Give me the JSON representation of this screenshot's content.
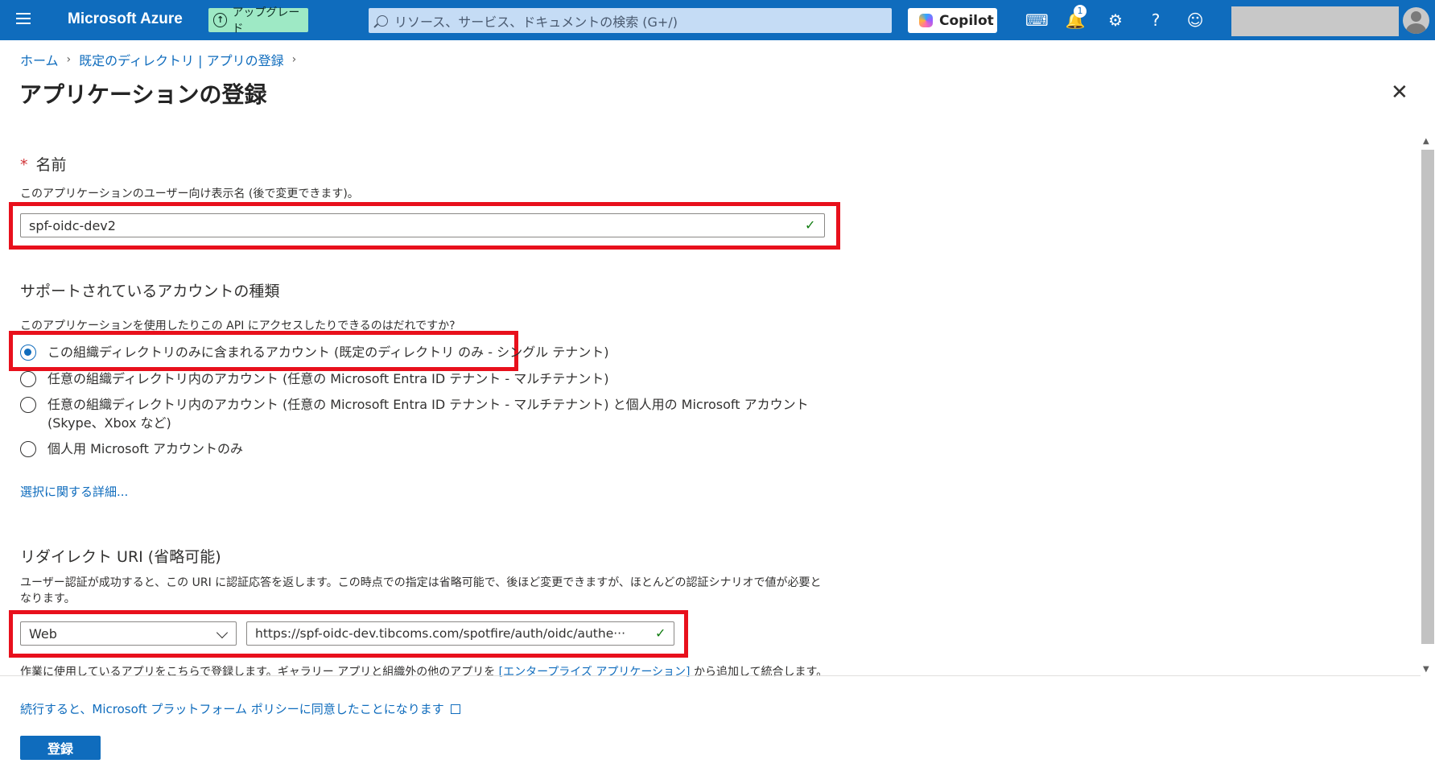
{
  "header": {
    "brand": "Microsoft Azure",
    "upgrade_label": "アップグレード",
    "search_placeholder": "リソース、サービス、ドキュメントの検索 (G+/)",
    "copilot_label": "Copilot",
    "notification_count": "1",
    "accent_color": "#0f6cbd"
  },
  "breadcrumb": {
    "home": "ホーム",
    "directory": "既定のディレクトリ | アプリの登録"
  },
  "page": {
    "title": "アプリケーションの登録",
    "more": "···",
    "close": "✕"
  },
  "name_section": {
    "label": "名前",
    "required_mark": "*",
    "description": "このアプリケーションのユーザー向け表示名 (後で変更できます)。",
    "value": "spf-oidc-dev2"
  },
  "account_section": {
    "title": "サポートされているアカウントの種類",
    "question": "このアプリケーションを使用したりこの API にアクセスしたりできるのはだれですか?",
    "options": [
      {
        "label": "この組織ディレクトリのみに含まれるアカウント (既定のディレクトリ のみ - シングル テナント)",
        "selected": true
      },
      {
        "label": "任意の組織ディレクトリ内のアカウント (任意の Microsoft Entra ID テナント - マルチテナント)",
        "selected": false
      },
      {
        "label": "任意の組織ディレクトリ内のアカウント (任意の Microsoft Entra ID テナント - マルチテナント) と個人用の Microsoft アカウント (Skype、Xbox など)",
        "selected": false
      },
      {
        "label": "個人用 Microsoft アカウントのみ",
        "selected": false
      }
    ],
    "details_link": "選択に関する詳細..."
  },
  "redirect_section": {
    "title": "リダイレクト URI (省略可能)",
    "description": "ユーザー認証が成功すると、この URI に認証応答を返します。この時点での指定は省略可能で、後ほど変更できますが、ほとんどの認証シナリオで値が必要となります。",
    "platform": "Web",
    "uri": "https://spf-oidc-dev.tibcoms.com/spotfire/auth/oidc/authe···",
    "note_prefix": "作業に使用しているアプリをこちらで登録します。ギャラリー アプリと組織外の他のアプリを",
    "note_link": "[エンタープライズ アプリケーション]",
    "note_suffix": "から追加して統合します。"
  },
  "footer": {
    "policy_link": "続行すると、Microsoft プラットフォーム ポリシーに同意したことになります",
    "register_button": "登録"
  }
}
